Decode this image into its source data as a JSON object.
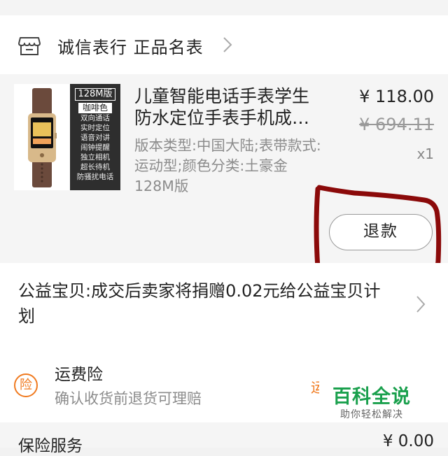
{
  "shop": {
    "name": "诚信表行 正品名表",
    "icon": "store-icon"
  },
  "product": {
    "thumbnail": {
      "badge": "128M版",
      "color_badge": "咖啡色",
      "features": [
        "双向通话",
        "实时定位",
        "语音对讲",
        "闹钟提醒",
        "独立相机",
        "超长待机",
        "防骚扰电话"
      ]
    },
    "title": "儿童智能电话手表学生防水定位手表手机成人男女多功能",
    "spec": "版本类型:中国大陆;表带款式:运动型;颜色分类:土豪金128M版",
    "price": "¥ 118.00",
    "original_price": "¥ 694.11",
    "quantity": "x1",
    "refund_label": "退款"
  },
  "charity": {
    "text": "公益宝贝:成交后卖家将捐赠0.02元给公益宝贝计划"
  },
  "insurance": {
    "icon_char": "险",
    "title": "运费险",
    "desc": "确认收货前退货可理赔",
    "tag": "运"
  },
  "watermark": {
    "title": "百科全说",
    "subtitle": "助你轻松解决"
  },
  "service": {
    "label": "保险服务",
    "price": "¥ 0.00"
  },
  "colors": {
    "accent": "#f07a1f",
    "annotation": "#8b0a0a",
    "watermark": "#1aa04d"
  }
}
